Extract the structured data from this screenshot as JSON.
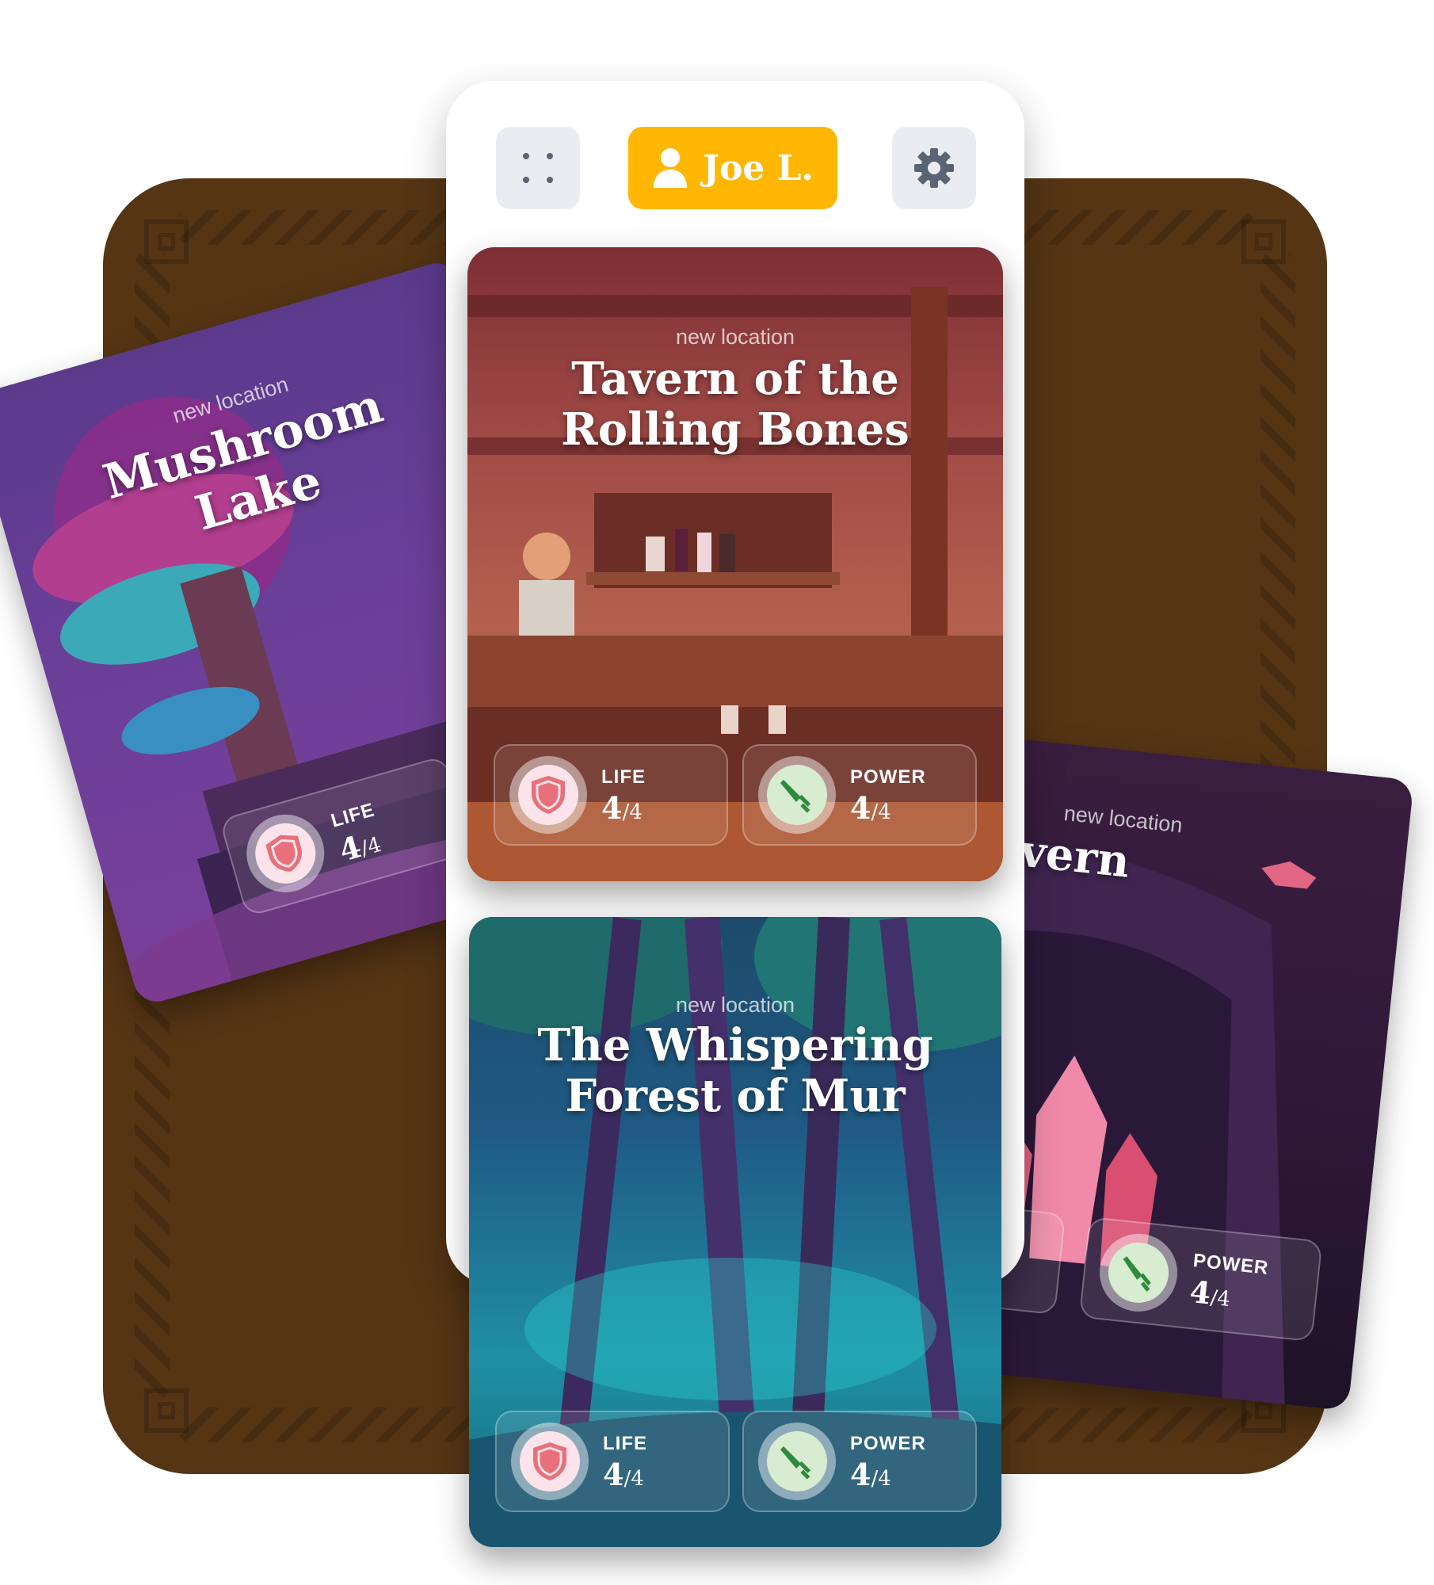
{
  "header": {
    "user_name": "Joe L.",
    "menu_icon": "grid-dots-icon",
    "settings_icon": "gear-icon",
    "accent_color": "#ffb703"
  },
  "cards": [
    {
      "kicker": "new location",
      "title_line1": "Mushroom",
      "title_line2": "Lake",
      "life_label": "LIFE",
      "life_value": "4",
      "life_max": "/4"
    },
    {
      "kicker": "new location",
      "title_line1": "Tavern of the",
      "title_line2": "Rolling Bones",
      "life_label": "LIFE",
      "life_value": "4",
      "life_max": "/4",
      "power_label": "POWER",
      "power_value": "4",
      "power_max": "/4"
    },
    {
      "kicker": "new location",
      "title_line1": "The Whispering",
      "title_line2": "Forest of Mur",
      "life_label": "LIFE",
      "life_value": "4",
      "life_max": "/4",
      "power_label": "POWER",
      "power_value": "4",
      "power_max": "/4"
    },
    {
      "kicker": "new location",
      "title_line1": "ridge Cavern",
      "power_label": "POWER",
      "power_value": "4",
      "power_max": "/4"
    }
  ],
  "icons": {
    "life": "shield-icon",
    "power": "sword-icon"
  },
  "colors": {
    "board": "#553514",
    "life_badge": "#fde3ea",
    "life_icon": "#e8707a",
    "power_badge": "#d7ecd0",
    "power_icon": "#2e8b3e"
  }
}
